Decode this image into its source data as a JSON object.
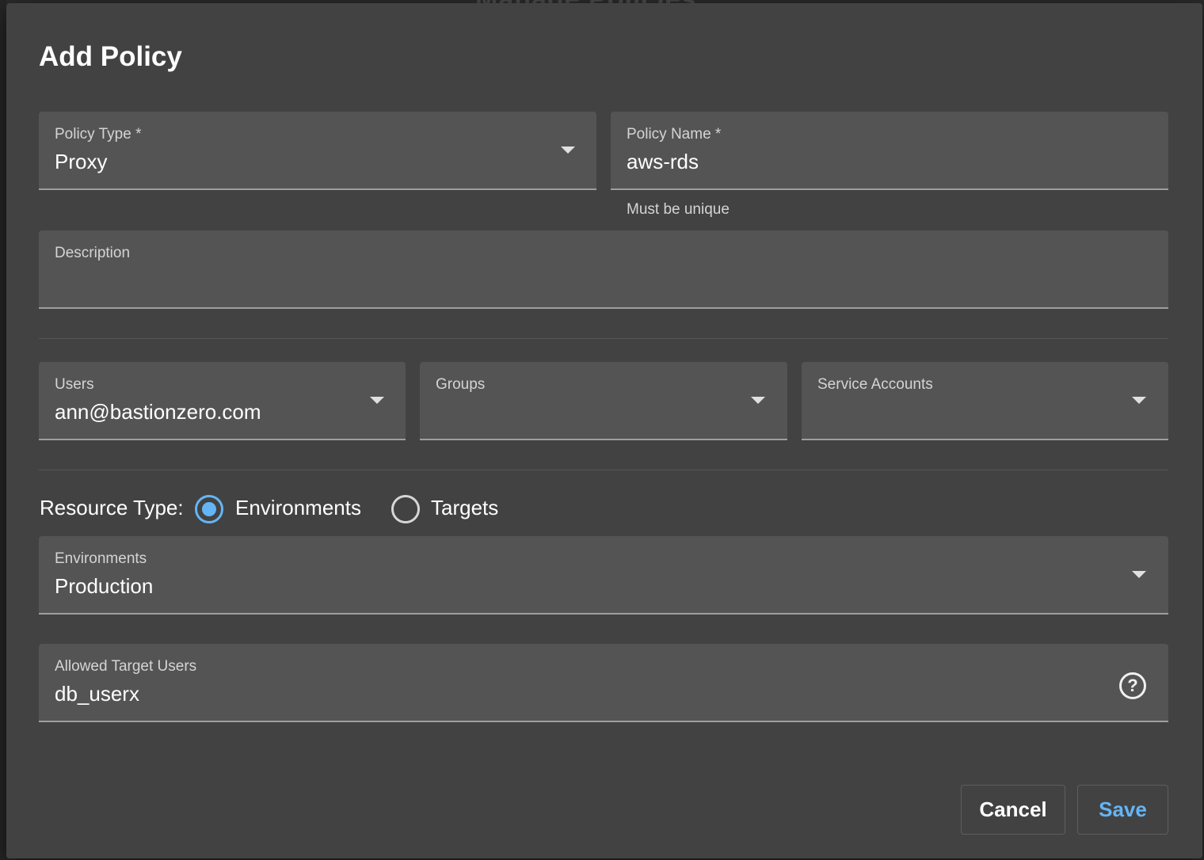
{
  "backdrop": {
    "title": "Manage Policies"
  },
  "dialog": {
    "title": "Add Policy",
    "policy_type": {
      "label": "Policy Type *",
      "value": "Proxy"
    },
    "policy_name": {
      "label": "Policy Name *",
      "value": "aws-rds",
      "hint": "Must be unique"
    },
    "description": {
      "label": "Description",
      "value": ""
    },
    "users": {
      "label": "Users",
      "value": "ann@bastionzero.com"
    },
    "groups": {
      "label": "Groups",
      "value": ""
    },
    "service_accounts": {
      "label": "Service Accounts",
      "value": ""
    },
    "resource_type": {
      "label": "Resource Type:",
      "options": [
        {
          "label": "Environments",
          "checked": true
        },
        {
          "label": "Targets",
          "checked": false
        }
      ]
    },
    "environments": {
      "label": "Environments",
      "value": "Production"
    },
    "allowed_target_users": {
      "label": "Allowed Target Users",
      "value": "db_userx",
      "help_icon": "?"
    },
    "buttons": {
      "cancel": "Cancel",
      "save": "Save"
    }
  },
  "colors": {
    "accent": "#64b5f6",
    "dialog_bg": "#424242",
    "field_bg": "#545454"
  }
}
